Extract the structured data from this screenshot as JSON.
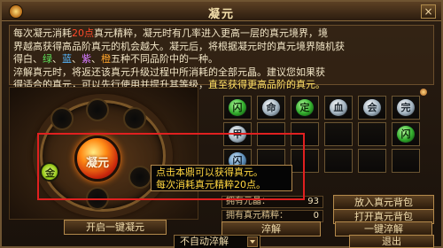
{
  "window": {
    "title": "凝元",
    "close_label": "×"
  },
  "description": {
    "line1_a": "每次凝元消耗",
    "line1_cost": "20点",
    "line1_b": "真元精粹，凝元时有几率进入更高一层的真元境界，境",
    "line2": "界越高获得高品阶真元的机会越大。凝元后，将根据凝元时的真元境界随机获",
    "line3_a": "得",
    "q_white": "白",
    "q_green": "绿",
    "q_blue": "蓝",
    "q_purple": "紫",
    "q_orange": "橙",
    "line3_b": "五种不同品阶中的一种。",
    "line4": "淬解真元时，将返还该真元升级过程中所消耗的全部元晶。建议您如果获",
    "line5_a": "得适合的真元，可以先行使用并提升其等级，",
    "line5_b": "直至获得更高品阶的真元。"
  },
  "core": {
    "label": "凝元"
  },
  "lime_gem": {
    "glyph": "金"
  },
  "tooltip": {
    "line1": "点击本鼎可以获得真元。",
    "line2": "每次消耗真元精粹20点。"
  },
  "grid": {
    "rows": [
      [
        {
          "type": "green",
          "glyph": "闪"
        },
        {
          "type": "silver",
          "glyph": "命"
        },
        {
          "type": "green",
          "glyph": "定"
        },
        {
          "type": "silver",
          "glyph": "血"
        },
        {
          "type": "silver",
          "glyph": "会"
        },
        {
          "type": "silver",
          "glyph": "完"
        }
      ],
      [
        {
          "type": "silver",
          "glyph": "甲"
        },
        {
          "type": "empty",
          "glyph": ""
        },
        {
          "type": "empty",
          "glyph": ""
        },
        {
          "type": "empty",
          "glyph": ""
        },
        {
          "type": "empty",
          "glyph": ""
        },
        {
          "type": "green",
          "glyph": "闪"
        }
      ],
      [
        {
          "type": "blue",
          "glyph": "闪"
        },
        {
          "type": "empty",
          "glyph": ""
        },
        {
          "type": "empty",
          "glyph": ""
        },
        {
          "type": "empty",
          "glyph": ""
        },
        {
          "type": "empty",
          "glyph": ""
        },
        {
          "type": "empty",
          "glyph": ""
        }
      ]
    ]
  },
  "stats": {
    "owned_yuanjing_label": "拥有元晶：",
    "owned_yuanjing_value": "93",
    "owned_essence_label": "拥有真元精粹：",
    "owned_essence_value": "0"
  },
  "buttons": {
    "one_click_condense": "开启一键凝元",
    "quench": "淬解",
    "one_click_quench": "一键淬解",
    "put_in_pack": "放入真元背包",
    "open_pack": "打开真元背包",
    "exit": "退出"
  },
  "auto_quench_select": {
    "value": "不自动淬解"
  }
}
